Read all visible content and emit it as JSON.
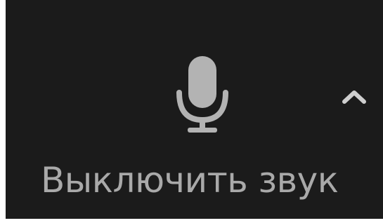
{
  "toolbar": {
    "mute_button": {
      "label": "Выключить звук",
      "icon": "microphone-icon",
      "menu_icon": "chevron-up-icon"
    }
  },
  "colors": {
    "background": "#1b1b1b",
    "icon": "#b3b3b3",
    "label": "#a9a9a9",
    "frame": "#ffffff"
  }
}
